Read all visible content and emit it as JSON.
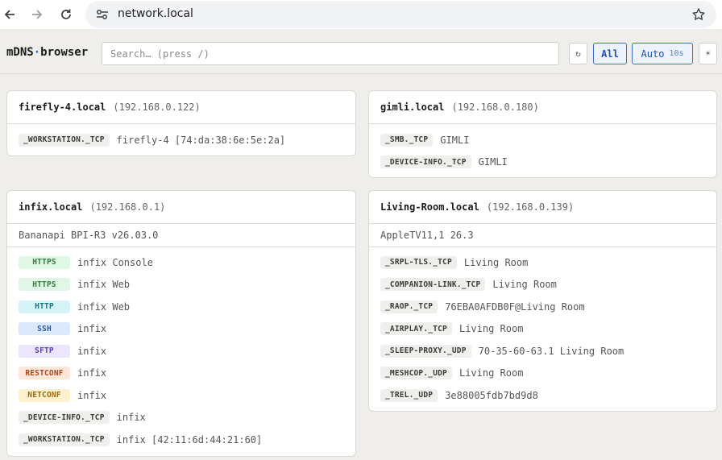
{
  "browser": {
    "url": "network.local",
    "icons": {
      "back": "arrow-left-icon",
      "forward": "arrow-right-icon",
      "reload": "reload-icon",
      "site_info": "tune-icon",
      "bookmark": "star-icon"
    }
  },
  "app": {
    "brand_left": "mDNS",
    "brand_sep": "·",
    "brand_right": "browser",
    "search_placeholder": "Search… (press /)",
    "refresh_label": "↻",
    "filter_all_label": "All",
    "auto_label": "Auto",
    "auto_interval": "10s",
    "theme_label": "☀",
    "colors": {
      "accent": "#3d6fc9",
      "accent_bg": "#edf3fd"
    }
  },
  "hosts": [
    {
      "name": "firefly-4.local",
      "ip": "(192.168.0.122)",
      "info": "",
      "services": [
        {
          "type": "_WORKSTATION._TCP",
          "name": "firefly-4 [74:da:38:6e:5e:2a]"
        }
      ]
    },
    {
      "name": "gimli.local",
      "ip": "(192.168.0.180)",
      "info": "",
      "services": [
        {
          "type": "_SMB._TCP",
          "name": "GIMLI"
        },
        {
          "type": "_DEVICE-INFO._TCP",
          "name": "GIMLI"
        }
      ]
    },
    {
      "name": "infix.local",
      "ip": "(192.168.0.1)",
      "info": "Bananapi BPI-R3 v26.03.0",
      "services": [
        {
          "type": "HTTPS",
          "name": "infix Console"
        },
        {
          "type": "HTTPS",
          "name": "infix Web"
        },
        {
          "type": "HTTP",
          "name": "infix Web"
        },
        {
          "type": "SSH",
          "name": "infix"
        },
        {
          "type": "SFTP",
          "name": "infix"
        },
        {
          "type": "RESTCONF",
          "name": "infix"
        },
        {
          "type": "NETCONF",
          "name": "infix"
        },
        {
          "type": "_DEVICE-INFO._TCP",
          "name": "infix"
        },
        {
          "type": "_WORKSTATION._TCP",
          "name": "infix [42:11:6d:44:21:60]"
        }
      ]
    },
    {
      "name": "Living-Room.local",
      "ip": "(192.168.0.139)",
      "info": "AppleTV11,1 26.3",
      "services": [
        {
          "type": "_SRPL-TLS._TCP",
          "name": "Living Room"
        },
        {
          "type": "_COMPANION-LINK._TCP",
          "name": "Living Room"
        },
        {
          "type": "_RAOP._TCP",
          "name": "76EBA0AFDB0F@Living Room"
        },
        {
          "type": "_AIRPLAY._TCP",
          "name": "Living Room"
        },
        {
          "type": "_SLEEP-PROXY._UDP",
          "name": "70-35-60-63.1 Living Room"
        },
        {
          "type": "_MESHCOP._UDP",
          "name": "Living Room"
        },
        {
          "type": "_TREL._UDP",
          "name": "3e88005fdb7bd9d8"
        }
      ]
    }
  ]
}
